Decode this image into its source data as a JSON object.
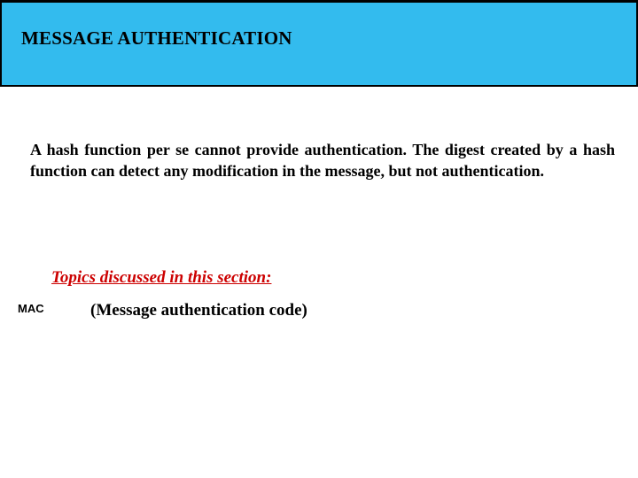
{
  "title": "MESSAGE AUTHENTICATION",
  "paragraph": "A hash function per se cannot provide authentication. The digest created by a hash function can detect any modification in the message, but not authentication.",
  "topics_heading": "Topics discussed in this section:",
  "mac": {
    "label": "MAC",
    "description": "(Message authentication code)"
  },
  "colors": {
    "title_bg": "#33bbee",
    "heading_red": "#cc0000"
  }
}
